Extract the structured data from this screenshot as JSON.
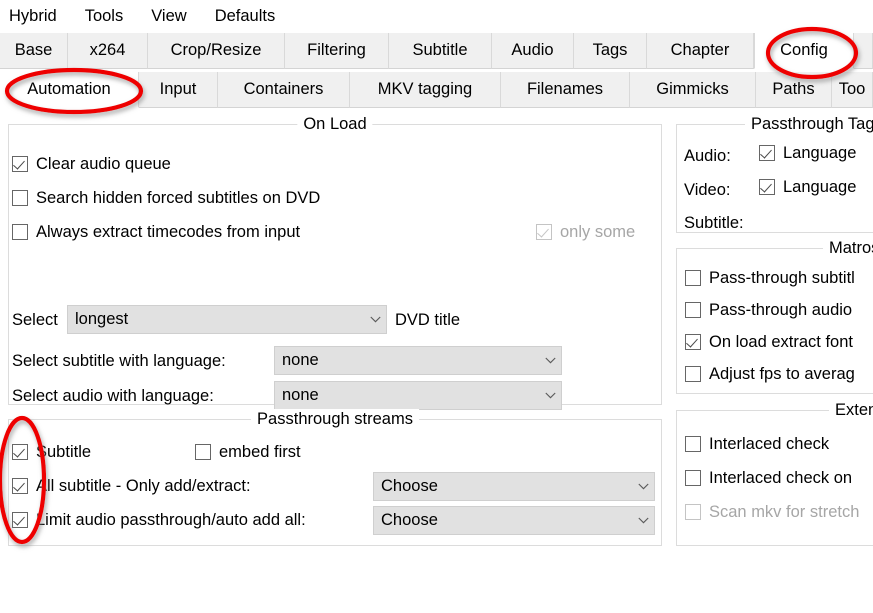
{
  "menubar": {
    "items": [
      {
        "label": "Hybrid"
      },
      {
        "label": "Tools"
      },
      {
        "label": "View"
      },
      {
        "label": "Defaults"
      }
    ]
  },
  "tabs_primary": {
    "items": [
      {
        "label": "Base",
        "active": false
      },
      {
        "label": "x264",
        "active": false
      },
      {
        "label": "Crop/Resize",
        "active": false
      },
      {
        "label": "Filtering",
        "active": false
      },
      {
        "label": "Subtitle",
        "active": false
      },
      {
        "label": "Audio",
        "active": false
      },
      {
        "label": "Tags",
        "active": false
      },
      {
        "label": "Chapter",
        "active": false
      },
      {
        "label": "Config",
        "active": true
      }
    ],
    "selected": "Config"
  },
  "tabs_secondary": {
    "items": [
      {
        "label": "Automation",
        "active": true
      },
      {
        "label": "Input",
        "active": false
      },
      {
        "label": "Containers",
        "active": false
      },
      {
        "label": "MKV tagging",
        "active": false
      },
      {
        "label": "Filenames",
        "active": false
      },
      {
        "label": "Gimmicks",
        "active": false
      },
      {
        "label": "Paths",
        "active": false
      },
      {
        "label": "Too",
        "active": false
      }
    ],
    "selected": "Automation"
  },
  "on_load": {
    "title": "On Load",
    "checkboxes": [
      {
        "label": "Clear audio queue",
        "checked": true,
        "disabled": false
      },
      {
        "label": "Search hidden forced subtitles on DVD",
        "checked": false,
        "disabled": false
      },
      {
        "label": "Always extract timecodes from input",
        "checked": false,
        "disabled": false
      }
    ],
    "only_some": {
      "label": "only some",
      "checked": true,
      "disabled": true
    },
    "dvd_title": {
      "prefix_label": "Select",
      "suffix_label": "DVD title",
      "value": "longest"
    },
    "subtitle_language": {
      "label": "Select subtitle with language:",
      "value": "none"
    },
    "audio_language": {
      "label": "Select audio with language:",
      "value": "none"
    }
  },
  "passthrough_streams": {
    "title": "Passthrough streams",
    "rows": [
      {
        "label": "Subtitle",
        "checked": true,
        "combo": null
      },
      {
        "label": "All subtitle - Only add/extract:",
        "checked": true,
        "combo": "Choose"
      },
      {
        "label": "Limit audio passthrough/auto add all:",
        "checked": true,
        "combo": "Choose"
      }
    ],
    "embed_first": {
      "label": "embed first",
      "checked": false
    }
  },
  "passthrough_tags": {
    "title": "Passthrough Tag",
    "rows": [
      {
        "name": "Audio:",
        "checkbox_label": "Language",
        "checked": true,
        "has_checkbox": true
      },
      {
        "name": "Video:",
        "checkbox_label": "Language",
        "checked": true,
        "has_checkbox": true
      },
      {
        "name": "Subtitle:",
        "checkbox_label": "",
        "checked": false,
        "has_checkbox": false
      }
    ]
  },
  "matroska": {
    "title": "Matros",
    "checkboxes": [
      {
        "label": "Pass-through subtitl",
        "checked": false,
        "disabled": false
      },
      {
        "label": "Pass-through audio",
        "checked": false,
        "disabled": false
      },
      {
        "label": "On load extract font",
        "checked": true,
        "disabled": false
      },
      {
        "label": "Adjust fps to averag",
        "checked": false,
        "disabled": false
      }
    ]
  },
  "extended": {
    "title": "Extend",
    "checkboxes": [
      {
        "label": "Interlaced check",
        "checked": false,
        "disabled": false
      },
      {
        "label": "Interlaced check on",
        "checked": false,
        "disabled": false
      },
      {
        "label": "Scan mkv for stretch",
        "checked": false,
        "disabled": true
      }
    ]
  },
  "annotations": {
    "color": "#ee0000",
    "ellipses": [
      {
        "name": "highlight-automation-tab"
      },
      {
        "name": "highlight-config-tab"
      },
      {
        "name": "highlight-passthrough-checkboxes"
      }
    ]
  },
  "colors": {
    "accent_red": "#ee0000",
    "combo_fill": "#e1e1e1",
    "tab_inactive": "#f0f0f0",
    "background": "#ffffff",
    "disabled_text": "#a6a6a6"
  }
}
